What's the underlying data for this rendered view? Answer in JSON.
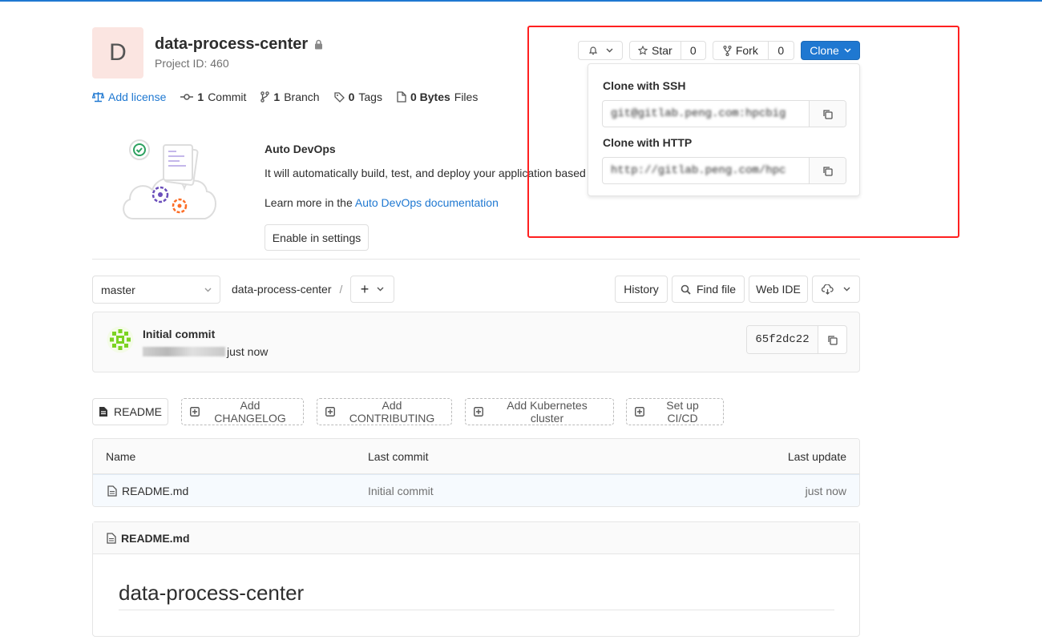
{
  "project": {
    "avatar_letter": "D",
    "name": "data-process-center",
    "id_text": "Project ID: 460"
  },
  "stats": {
    "license": "Add license",
    "commits_count": "1",
    "commits_label": "Commit",
    "branches_count": "1",
    "branches_label": "Branch",
    "tags_count": "0",
    "tags_label": "Tags",
    "files_count": "0 Bytes",
    "files_label": "Files"
  },
  "actions": {
    "star_label": "Star",
    "star_count": "0",
    "fork_label": "Fork",
    "fork_count": "0",
    "clone_label": "Clone"
  },
  "clone_dropdown": {
    "ssh_label": "Clone with SSH",
    "ssh_url": "git@gitlab.peng.com:hpcbig",
    "http_label": "Clone with HTTP",
    "http_url": "http://gitlab.peng.com/hpc"
  },
  "devops": {
    "title": "Auto DevOps",
    "description": "It will automatically build, test, and deploy your application based",
    "learn_prefix": "Learn more in the",
    "learn_link": "Auto DevOps documentation",
    "enable_button": "Enable in settings"
  },
  "repo_nav": {
    "branch": "master",
    "breadcrumb": "data-process-center",
    "separator": "/",
    "add_symbol": "+",
    "history": "History",
    "find_file": "Find file",
    "web_ide": "Web IDE"
  },
  "last_commit": {
    "title": "Initial commit",
    "time": "just now",
    "sha": "65f2dc22"
  },
  "tabs": {
    "readme": "README",
    "changelog": "Add CHANGELOG",
    "contributing": "Add CONTRIBUTING",
    "kubernetes": "Add Kubernetes cluster",
    "cicd": "Set up CI/CD"
  },
  "file_table": {
    "headers": {
      "name": "Name",
      "last_commit": "Last commit",
      "last_update": "Last update"
    },
    "rows": [
      {
        "name": "README.md",
        "commit": "Initial commit",
        "updated": "just now"
      }
    ]
  },
  "readme": {
    "file_name": "README.md",
    "heading": "data-process-center"
  },
  "colors": {
    "primary": "#1f78d1",
    "highlight": "#ff2020",
    "avatar_bg": "#fbe5e1"
  }
}
